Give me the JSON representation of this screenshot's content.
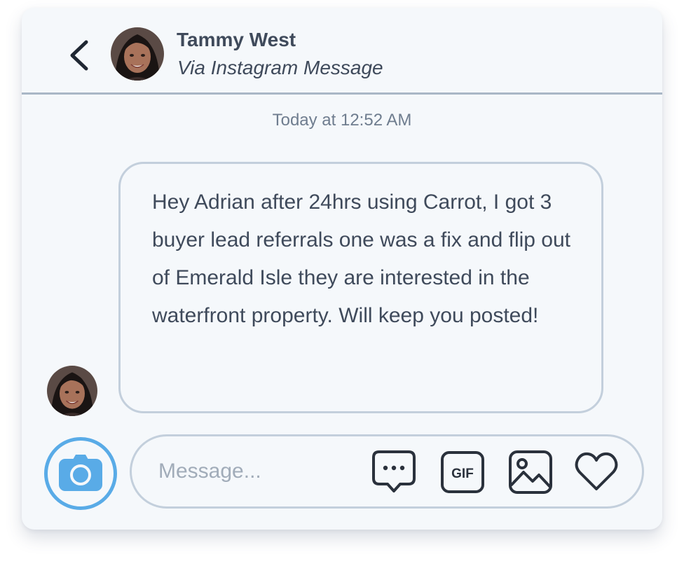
{
  "header": {
    "contact_name": "Tammy West",
    "channel": "Via Instagram Message"
  },
  "conversation": {
    "timestamp": "Today at 12:52 AM",
    "messages": [
      {
        "sender": "Tammy West",
        "text": "Hey Adrian after 24hrs using Carrot, I got 3 buyer lead referrals one was a fix and flip out of Emerald Isle they are interested in the waterfront property. Will keep you posted!"
      }
    ]
  },
  "composer": {
    "placeholder": "Message...",
    "value": "",
    "gif_label": "GIF",
    "icons": [
      "camera-icon",
      "chat-bubble-icon",
      "gif-icon",
      "image-icon",
      "heart-icon"
    ]
  },
  "colors": {
    "card_background": "#f5f8fb",
    "text": "#3f4a5b",
    "muted_text": "#6f7d8f",
    "divider": "#a9b7c6",
    "bubble_border": "#c3cfdc",
    "camera_accent": "#59abe7"
  }
}
